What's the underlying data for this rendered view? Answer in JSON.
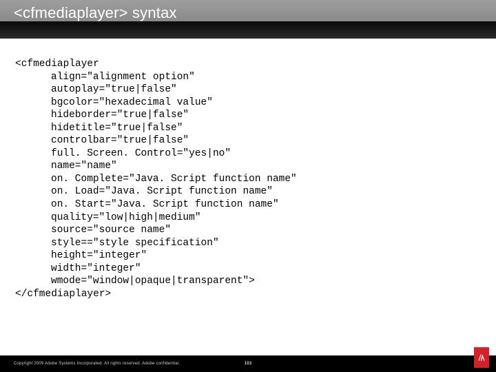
{
  "header": {
    "title": "<cfmediaplayer> syntax"
  },
  "code": {
    "open": "<cfmediaplayer",
    "attrs": [
      "align=\"alignment option\"",
      "autoplay=\"true|false\"",
      "bgcolor=\"hexadecimal value\"",
      "hideborder=\"true|false\"",
      "hidetitle=\"true|false\"",
      "controlbar=\"true|false\"",
      "full. Screen. Control=\"yes|no\"",
      "name=\"name\"",
      "on. Complete=\"Java. Script function name\"",
      "on. Load=\"Java. Script function name\"",
      "on. Start=\"Java. Script function name\"",
      "quality=\"low|high|medium\"",
      "source=\"source name\"",
      "style==\"style specification\"",
      "height=\"integer\"",
      "width=\"integer\"",
      "wmode=\"window|opaque|transparent\">"
    ],
    "close": "</cfmediaplayer>"
  },
  "footer": {
    "copyright": "Copyright 2009 Adobe Systems Incorporated.  All rights reserved.  Adobe confidential.",
    "page": "103"
  }
}
